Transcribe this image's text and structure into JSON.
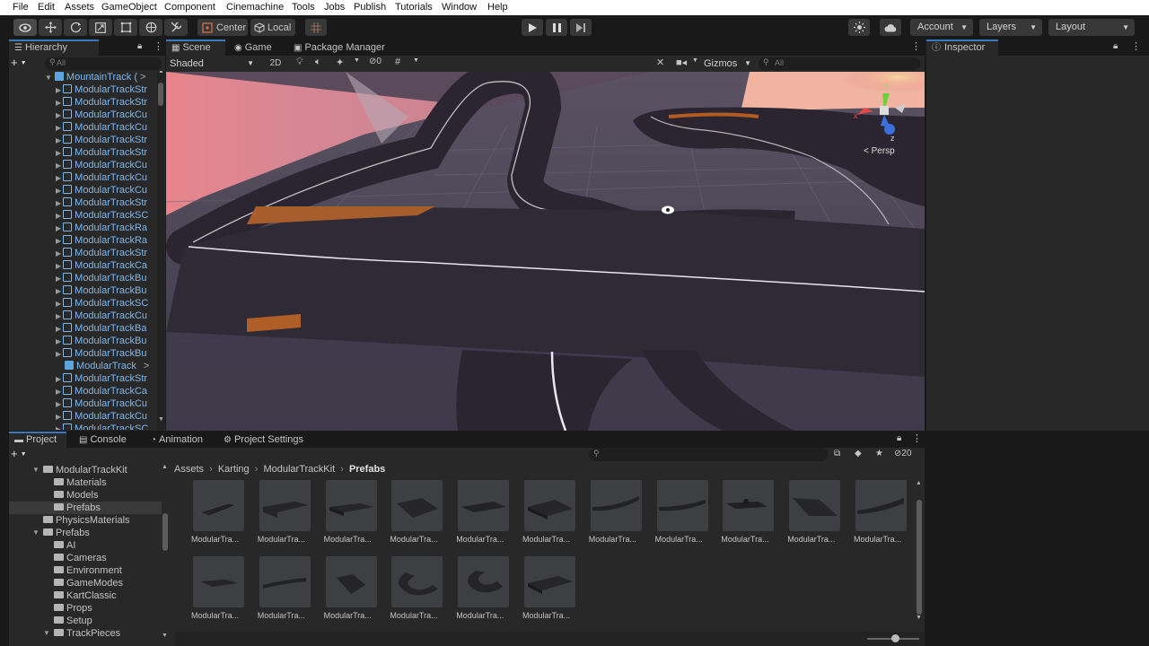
{
  "menu": [
    "File",
    "Edit",
    "Assets",
    "GameObject",
    "Component",
    "Cinemachine",
    "Tools",
    "Jobs",
    "Publish",
    "Tutorials",
    "Window",
    "Help"
  ],
  "toolbar": {
    "center_label": "Center",
    "local_label": "Local",
    "account_label": "Account",
    "layers_label": "Layers",
    "layout_label": "Layout"
  },
  "hierarchy": {
    "tab_label": "Hierarchy",
    "search_placeholder": "All",
    "root_label": "MountainTrack (",
    "items": [
      "ModularTrackStr",
      "ModularTrackStr",
      "ModularTrackCu",
      "ModularTrackCu",
      "ModularTrackStr",
      "ModularTrackStr",
      "ModularTrackCu",
      "ModularTrackCu",
      "ModularTrackCu",
      "ModularTrackStr",
      "ModularTrackSC",
      "ModularTrackRa",
      "ModularTrackRa",
      "ModularTrackStr",
      "ModularTrackCa",
      "ModularTrackBu",
      "ModularTrackBu",
      "ModularTrackSC",
      "ModularTrackCu",
      "ModularTrackBa",
      "ModularTrackBu",
      "ModularTrackBu",
      "ModularTrack",
      "ModularTrackStr",
      "ModularTrackCa",
      "ModularTrackCu",
      "ModularTrackCu",
      "ModularTrackSC"
    ]
  },
  "scene": {
    "tabs": [
      "Scene",
      "Game",
      "Package Manager"
    ],
    "shading_mode": "Shaded",
    "mode_2d": "2D",
    "hidden_count": "0",
    "gizmos_label": "Gizmos",
    "search_placeholder": "All",
    "persp_label": "< Persp",
    "axis_y": "y",
    "axis_x": "x",
    "axis_z": "z"
  },
  "inspector": {
    "tab_label": "Inspector"
  },
  "bottom_tabs": [
    "Project",
    "Console",
    "Animation",
    "Project Settings"
  ],
  "project": {
    "hidden_count": "20",
    "breadcrumb": [
      "Assets",
      "Karting",
      "ModularTrackKit",
      "Prefabs"
    ],
    "tree": [
      {
        "label": "ModularTrackKit",
        "indent": 0,
        "open": true
      },
      {
        "label": "Materials",
        "indent": 1,
        "open": false
      },
      {
        "label": "Models",
        "indent": 1,
        "open": false
      },
      {
        "label": "Prefabs",
        "indent": 1,
        "open": false
      },
      {
        "label": "PhysicsMaterials",
        "indent": 0,
        "open": false
      },
      {
        "label": "Prefabs",
        "indent": 0,
        "open": true
      },
      {
        "label": "AI",
        "indent": 1,
        "open": false
      },
      {
        "label": "Cameras",
        "indent": 1,
        "open": false
      },
      {
        "label": "Environment",
        "indent": 1,
        "open": false
      },
      {
        "label": "GameModes",
        "indent": 1,
        "open": false
      },
      {
        "label": "KartClassic",
        "indent": 1,
        "open": false
      },
      {
        "label": "Props",
        "indent": 1,
        "open": false
      },
      {
        "label": "Setup",
        "indent": 1,
        "open": false
      },
      {
        "label": "TrackPieces",
        "indent": 1,
        "open": true
      }
    ],
    "assets": [
      "ModularTra...",
      "ModularTra...",
      "ModularTra...",
      "ModularTra...",
      "ModularTra...",
      "ModularTra...",
      "ModularTra...",
      "ModularTra...",
      "ModularTra...",
      "ModularTra...",
      "ModularTra...",
      "ModularTra...",
      "ModularTra...",
      "ModularTra...",
      "ModularTra...",
      "ModularTra...",
      "ModularTra..."
    ]
  },
  "colors": {
    "selection": "#2c5d87",
    "accent_tab": "#3a79bb",
    "sky": "#e9868a",
    "ground": "#4a4658"
  }
}
